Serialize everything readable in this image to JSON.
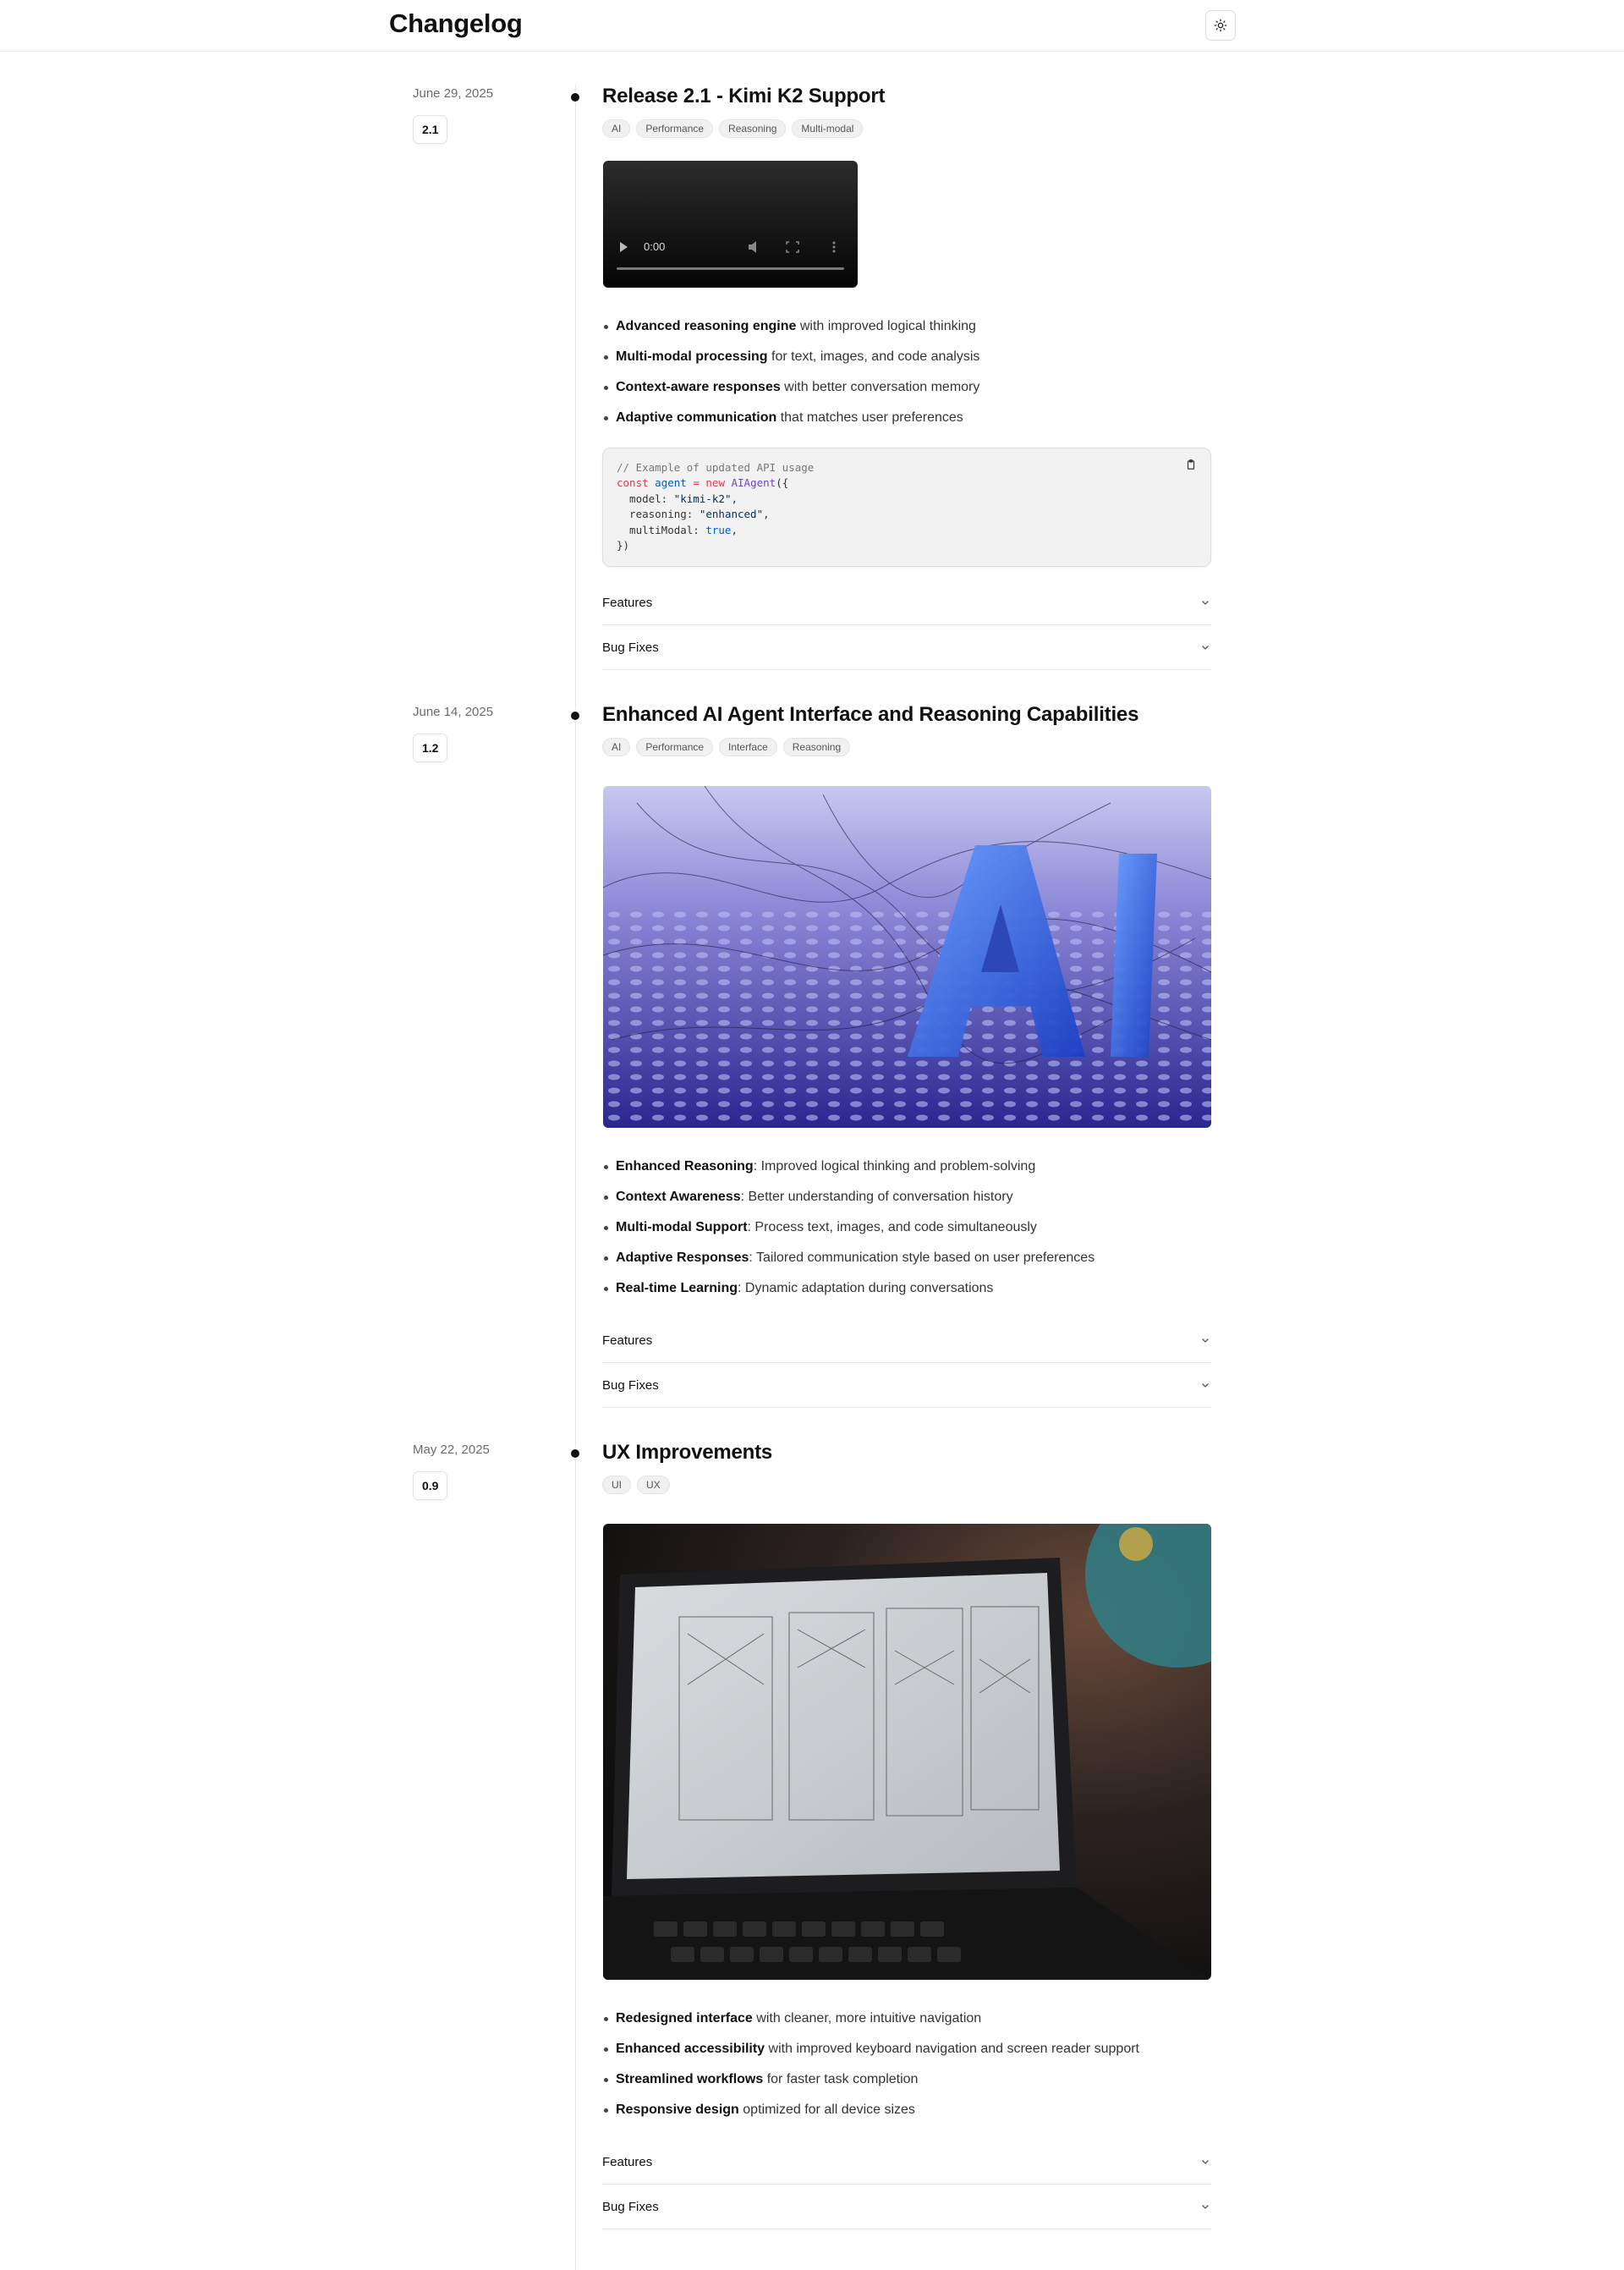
{
  "header": {
    "title": "Changelog",
    "theme_icon": "sun-icon"
  },
  "entries": [
    {
      "date": "June 29, 2025",
      "version": "2.1",
      "title": "Release 2.1 - Kimi K2 Support",
      "tags": [
        "AI",
        "Performance",
        "Reasoning",
        "Multi-modal"
      ],
      "media": {
        "type": "video",
        "time": "0:00"
      },
      "bullets": [
        {
          "strong": "Advanced reasoning engine",
          "rest": " with improved logical thinking"
        },
        {
          "strong": "Multi-modal processing",
          "rest": " for text, images, and code analysis"
        },
        {
          "strong": "Context-aware responses",
          "rest": " with better conversation memory"
        },
        {
          "strong": "Adaptive communication",
          "rest": " that matches user preferences"
        }
      ],
      "code": {
        "comment": "// Example of updated API usage",
        "kw_const": "const",
        "var_name": "agent",
        "eq": " = ",
        "kw_new": "new",
        "fn_name": "AIAgent",
        "open": "({",
        "model_key": "  model: ",
        "model_val": "\"kimi-k2\"",
        "reasoning_key": "  reasoning: ",
        "reasoning_val": "\"enhanced\"",
        "multimodal_key": "  multiModal: ",
        "multimodal_val": "true",
        "comma": ",",
        "close": "})"
      },
      "sections": [
        "Features",
        "Bug Fixes"
      ]
    },
    {
      "date": "June 14, 2025",
      "version": "1.2",
      "title": "Enhanced AI Agent Interface and Reasoning Capabilities",
      "tags": [
        "AI",
        "Performance",
        "Interface",
        "Reasoning"
      ],
      "media": {
        "type": "image",
        "alt": "AI"
      },
      "bullets": [
        {
          "strong": "Enhanced Reasoning",
          "rest": ": Improved logical thinking and problem-solving"
        },
        {
          "strong": "Context Awareness",
          "rest": ": Better understanding of conversation history"
        },
        {
          "strong": "Multi-modal Support",
          "rest": ": Process text, images, and code simultaneously"
        },
        {
          "strong": "Adaptive Responses",
          "rest": ": Tailored communication style based on user preferences"
        },
        {
          "strong": "Real-time Learning",
          "rest": ": Dynamic adaptation during conversations"
        }
      ],
      "sections": [
        "Features",
        "Bug Fixes"
      ]
    },
    {
      "date": "May 22, 2025",
      "version": "0.9",
      "title": "UX Improvements",
      "tags": [
        "UI",
        "UX"
      ],
      "media": {
        "type": "image"
      },
      "bullets": [
        {
          "strong": "Redesigned interface",
          "rest": " with cleaner, more intuitive navigation"
        },
        {
          "strong": "Enhanced accessibility",
          "rest": " with improved keyboard navigation and screen reader support"
        },
        {
          "strong": "Streamlined workflows",
          "rest": " for faster task completion"
        },
        {
          "strong": "Responsive design",
          "rest": " optimized for all device sizes"
        }
      ],
      "sections": [
        "Features",
        "Bug Fixes"
      ]
    }
  ]
}
